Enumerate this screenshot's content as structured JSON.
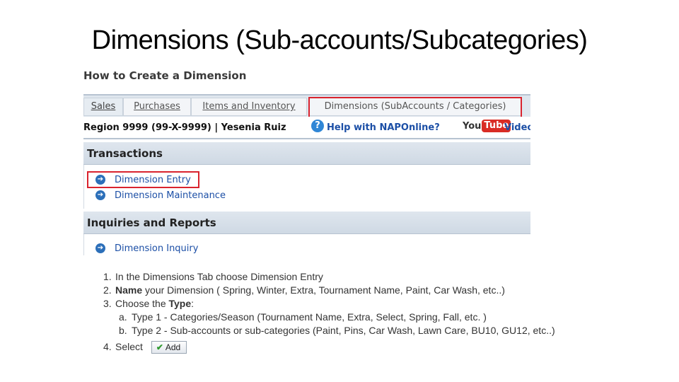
{
  "slide": {
    "title": "Dimensions (Sub-accounts/Subcategories)"
  },
  "doc": {
    "heading": "How to Create a Dimension"
  },
  "tabs": {
    "sales": "Sales",
    "purchases": "Purchases",
    "items": "Items and Inventory",
    "dimensions": "Dimensions (SubAccounts / Categories)"
  },
  "infobar": {
    "region": "Region 9999 (99-X-9999) | Yesenia Ruiz",
    "help_icon": "question-icon",
    "help_link": "Help with NAPOnline?",
    "youtube_you": "You",
    "youtube_tube": "Tube",
    "video_link": "Video"
  },
  "transactions": {
    "heading": "Transactions",
    "items": [
      "Dimension Entry",
      "Dimension Maintenance"
    ]
  },
  "inquiries": {
    "heading": "Inquiries and Reports",
    "items": [
      "Dimension Inquiry"
    ]
  },
  "steps": {
    "s1_num": "1.",
    "s1_text": "In the Dimensions Tab choose Dimension Entry",
    "s2_num": "2.",
    "s2_bold": "Name",
    "s2_text": " your Dimension ( Spring, Winter, Extra, Tournament Name, Paint, Car Wash, etc..)",
    "s3_num": "3.",
    "s3_pre": "Choose the ",
    "s3_bold": "Type",
    "s3_post": ":",
    "a_num": "a.",
    "a_text": "Type 1 - Categories/Season (Tournament Name, Extra, Select, Spring, Fall, etc. )",
    "b_num": "b.",
    "b_text": "Type 2 - Sub-accounts or sub-categories (Paint, Pins, Car Wash, Lawn Care, BU10, GU12, etc..)",
    "s4_num": "4.",
    "s4_text": "Select",
    "add_button": "Add"
  },
  "colors": {
    "highlight": "#d9232e",
    "link": "#1c4fa6",
    "header_bg": "#dfe6ee"
  }
}
